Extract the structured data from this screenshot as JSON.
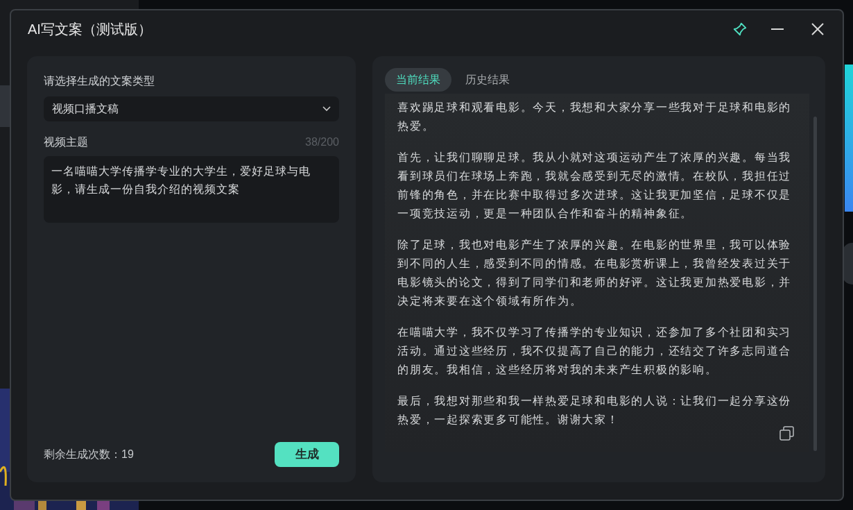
{
  "window": {
    "title": "AI写文案（测试版）",
    "pinned": true
  },
  "form": {
    "type_label": "请选择生成的文案类型",
    "type_select": {
      "value": "视频口播文稿"
    },
    "topic_label": "视频主题",
    "topic_counter": "38/200",
    "topic_input": {
      "value": "一名喵喵大学传播学专业的大学生，爱好足球与电影，请生成一份自我介绍的视频文案"
    },
    "remaining": "剩余生成次数：19",
    "generate_button": "生成"
  },
  "results": {
    "tabs": [
      {
        "label": "当前结果",
        "selected": true
      },
      {
        "label": "历史结果",
        "selected": false
      }
    ],
    "paragraphs": [
      "喜欢踢足球和观看电影。今天，我想和大家分享一些我对于足球和电影的热爱。",
      "首先，让我们聊聊足球。我从小就对这项运动产生了浓厚的兴趣。每当我看到球员们在球场上奔跑，我就会感受到无尽的激情。在校队，我担任过前锋的角色，并在比赛中取得过多次进球。这让我更加坚信，足球不仅是一项竞技运动，更是一种团队合作和奋斗的精神象征。",
      "除了足球，我也对电影产生了浓厚的兴趣。在电影的世界里，我可以体验到不同的人生，感受到不同的情感。在电影赏析课上，我曾经发表过关于电影镜头的论文，得到了同学们和老师的好评。这让我更加热爱电影，并决定将来要在这个领域有所作为。",
      "在喵喵大学，我不仅学习了传播学的专业知识，还参加了多个社团和实习活动。通过这些经历，我不仅提高了自己的能力，还结交了许多志同道合的朋友。我相信，这些经历将对我的未来产生积极的影响。",
      "最后，我想对那些和我一样热爱足球和电影的人说：让我们一起分享这份热爱，一起探索更多可能性。谢谢大家！"
    ]
  }
}
